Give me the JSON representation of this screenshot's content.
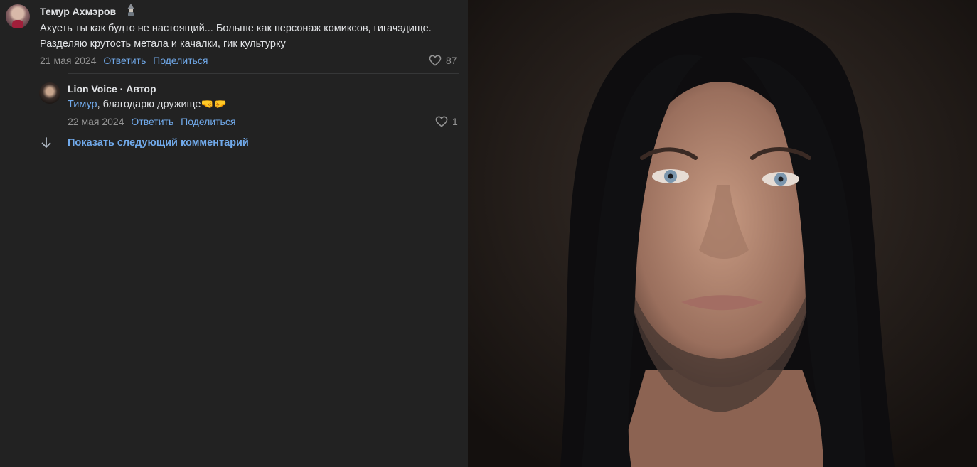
{
  "comments": [
    {
      "author": "Темур Ахмэров",
      "text": "Ахуеть ты как будто не настоящий... Больше как персонаж комиксов, гигачэдище. Разделяю крутость метала и качалки, гик культурку",
      "date": "21 мая 2024",
      "reply_label": "Ответить",
      "share_label": "Поделиться",
      "likes": "87"
    }
  ],
  "reply": {
    "author": "Lion Voice · Автор",
    "mention": "Тимур",
    "text": ", благодарю дружище🤜🤛",
    "date": "22 мая 2024",
    "reply_label": "Ответить",
    "share_label": "Поделиться",
    "likes": "1"
  },
  "show_next_label": "Показать следующий комментарий",
  "icons": {
    "like": "heart-icon",
    "expand": "arrow-down-icon",
    "badge": "gnome-emoji-icon"
  },
  "colors": {
    "background": "#222222",
    "link": "#71aaeb",
    "text": "#e1e3e6",
    "muted": "#939393"
  }
}
